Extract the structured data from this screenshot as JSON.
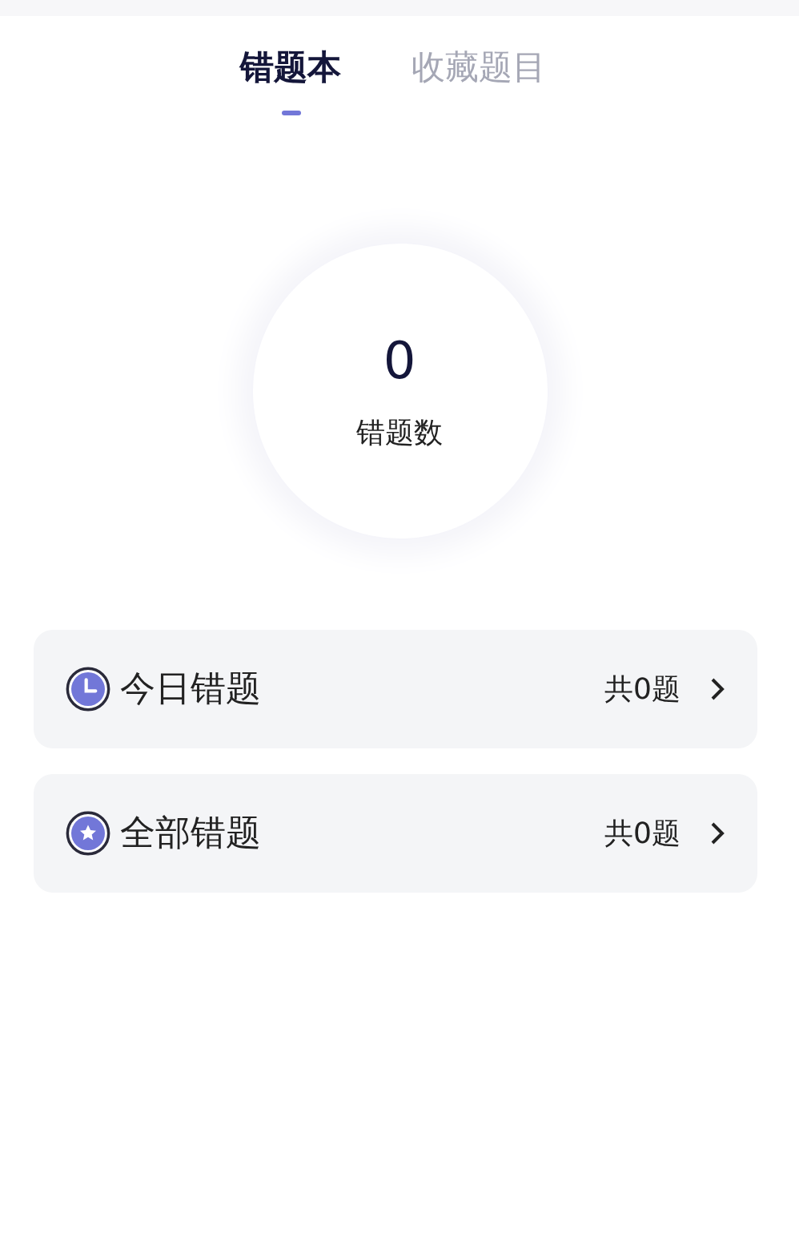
{
  "tabs": [
    {
      "label": "错题本",
      "selected": true
    },
    {
      "label": "收藏题目",
      "selected": false
    }
  ],
  "summary": {
    "count": "0",
    "label": "错题数"
  },
  "lists": [
    {
      "kind": "clock",
      "title": "今日错题",
      "total": "共0题"
    },
    {
      "kind": "star",
      "title": "全部错题",
      "total": "共0题"
    }
  ]
}
